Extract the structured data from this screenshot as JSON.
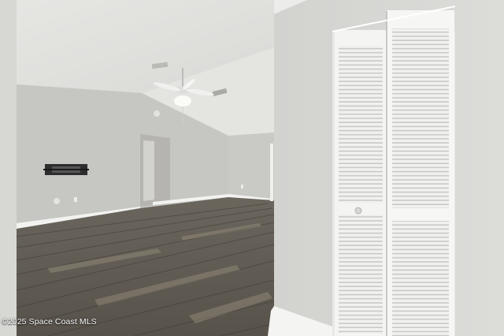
{
  "watermark": {
    "text": "©2025 Space Coast MLS"
  },
  "colors": {
    "ceiling": "#e2e2df",
    "wall_left": "#c8c8c4",
    "wall_back": "#cdcdc9",
    "wall_right": "#d6d6d3",
    "floor_dark": "#4e4b46",
    "floor_light": "#8c8476",
    "closet_door": "#f2f2f0",
    "baseboard": "#f6f6f4"
  },
  "icons": [
    "ceiling-fan-icon",
    "wall-art-icon",
    "closet-knob-icon"
  ]
}
